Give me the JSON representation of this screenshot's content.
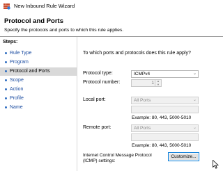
{
  "window": {
    "title": "New Inbound Rule Wizard"
  },
  "header": {
    "title": "Protocol and Ports",
    "subtitle": "Specify the protocols and ports to which this rule applies."
  },
  "sidebar": {
    "heading": "Steps:",
    "items": [
      {
        "label": "Rule Type",
        "active": false
      },
      {
        "label": "Program",
        "active": false
      },
      {
        "label": "Protocol and Ports",
        "active": true
      },
      {
        "label": "Scope",
        "active": false
      },
      {
        "label": "Action",
        "active": false
      },
      {
        "label": "Profile",
        "active": false
      },
      {
        "label": "Name",
        "active": false
      }
    ]
  },
  "main": {
    "question": "To which ports and protocols does this rule apply?",
    "protocol_type_label": "Protocol type:",
    "protocol_type_value": "ICMPv4",
    "protocol_number_label": "Protocol number:",
    "protocol_number_value": "1",
    "local_port_label": "Local port:",
    "local_port_value": "All Ports",
    "local_port_example": "Example: 80, 443, 5000-5010",
    "remote_port_label": "Remote port:",
    "remote_port_value": "All Ports",
    "remote_port_example": "Example: 80, 443, 5000-5010",
    "icmp_label": "Internet Control Message Protocol (ICMP) settings:",
    "customize_button": "Customize..."
  },
  "colors": {
    "link": "#1a4ba0",
    "active_step_bg": "#d9d9d9",
    "focus_border": "#0078d7"
  }
}
